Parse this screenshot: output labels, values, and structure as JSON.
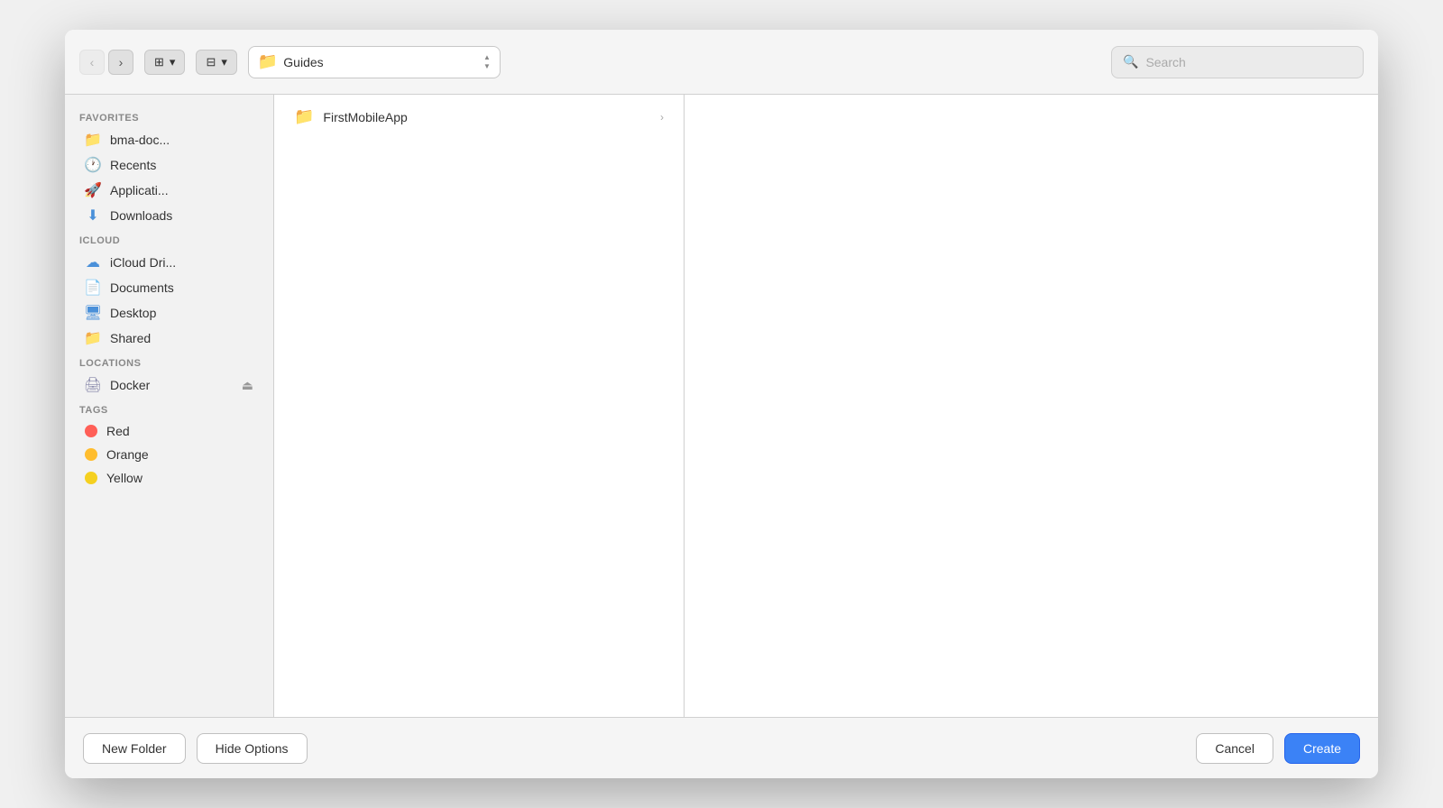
{
  "toolbar": {
    "back_label": "‹",
    "forward_label": "›",
    "view_columns_icon": "⊞",
    "view_grid_icon": "⊟",
    "view_dropdown": "▾",
    "path_label": "Guides",
    "search_placeholder": "Search"
  },
  "sidebar": {
    "favorites_label": "Favorites",
    "icloud_label": "iCloud",
    "locations_label": "Locations",
    "tags_label": "Tags",
    "items": [
      {
        "id": "bma-doc",
        "label": "bma-doc...",
        "icon": "📁"
      },
      {
        "id": "recents",
        "label": "Recents",
        "icon": "🕐"
      },
      {
        "id": "applications",
        "label": "Applicati...",
        "icon": "🚀"
      },
      {
        "id": "downloads",
        "label": "Downloads",
        "icon": "⬇"
      },
      {
        "id": "icloud-drive",
        "label": "iCloud Dri...",
        "icon": "☁"
      },
      {
        "id": "documents",
        "label": "Documents",
        "icon": "📄"
      },
      {
        "id": "desktop",
        "label": "Desktop",
        "icon": "🖥"
      },
      {
        "id": "shared",
        "label": "Shared",
        "icon": "📁"
      },
      {
        "id": "docker",
        "label": "Docker",
        "icon": "🖨"
      }
    ],
    "tags": [
      {
        "id": "red",
        "label": "Red",
        "color": "#ff5f57"
      },
      {
        "id": "orange",
        "label": "Orange",
        "color": "#ffbd2e"
      },
      {
        "id": "yellow",
        "label": "Yellow",
        "color": "#f5d020"
      }
    ]
  },
  "files": {
    "column1": [
      {
        "id": "firstmobileapp",
        "name": "FirstMobileApp",
        "type": "folder",
        "has_children": true
      }
    ]
  },
  "bottom_bar": {
    "new_folder_label": "New Folder",
    "hide_options_label": "Hide Options",
    "cancel_label": "Cancel",
    "create_label": "Create"
  }
}
